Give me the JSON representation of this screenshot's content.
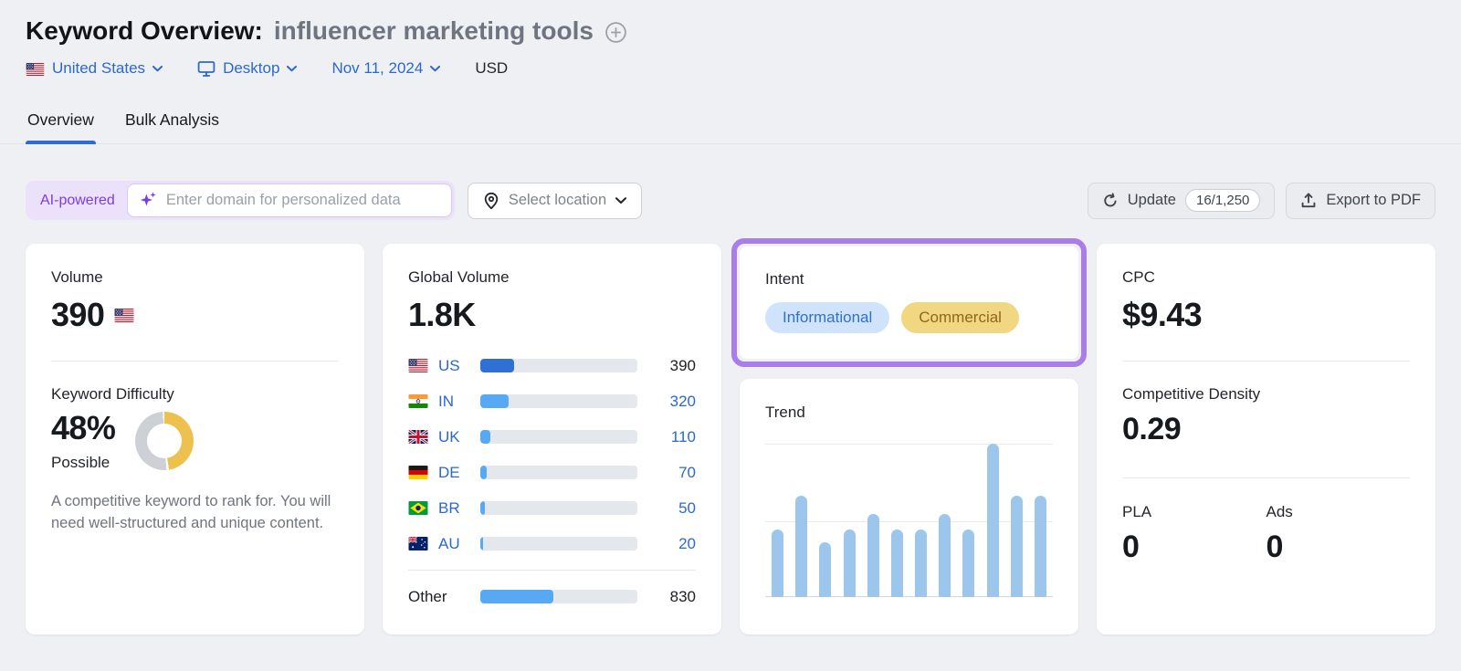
{
  "colors": {
    "accent_blue": "#2b68cf",
    "tab_underline_blue": "#2e6bd8",
    "highlight_purple": "#ab7de8",
    "ai_purple": "#7b3be8",
    "kd_ring_yellow": "#ecc14e",
    "kd_ring_gray": "#cdd1d6",
    "trend_bar_blue": "#9cc6ec",
    "us_bar_blue": "#2f70d4",
    "country_bar_blue": "#58a9f3",
    "informational_text": "#3270c8",
    "informational_bg": "#cfe4fb",
    "commercial_text": "#8d681a",
    "commercial_bg": "#f2d783"
  },
  "header": {
    "title": "Keyword Overview:",
    "keyword": "influencer marketing tools",
    "filters": {
      "country": "United States",
      "device": "Desktop",
      "date": "Nov 11, 2024",
      "currency": "USD"
    },
    "tabs": [
      {
        "label": "Overview"
      },
      {
        "label": "Bulk Analysis"
      }
    ]
  },
  "toolbar": {
    "ai_badge": "AI-powered",
    "domain_placeholder": "Enter domain for personalized data",
    "select_location": "Select location",
    "update_label": "Update",
    "update_count": "16/1,250",
    "export_label": "Export to PDF"
  },
  "cards": {
    "volume": {
      "label": "Volume",
      "value": "390"
    },
    "keyword_difficulty": {
      "label": "Keyword Difficulty",
      "value": "48%",
      "percent": 48,
      "verdict": "Possible",
      "description": "A competitive keyword to rank for. You will need well-structured and unique content."
    },
    "global_volume": {
      "label": "Global Volume",
      "value": "1.8K",
      "rows": [
        {
          "code": "US",
          "flag": "us",
          "value": 390,
          "display": "390",
          "emphasis": true
        },
        {
          "code": "IN",
          "flag": "in",
          "value": 320,
          "display": "320",
          "emphasis": false
        },
        {
          "code": "UK",
          "flag": "uk",
          "value": 110,
          "display": "110",
          "emphasis": false
        },
        {
          "code": "DE",
          "flag": "de",
          "value": 70,
          "display": "70",
          "emphasis": false
        },
        {
          "code": "BR",
          "flag": "br",
          "value": 50,
          "display": "50",
          "emphasis": false
        },
        {
          "code": "AU",
          "flag": "au",
          "value": 20,
          "display": "20",
          "emphasis": false
        }
      ],
      "other": {
        "label": "Other",
        "value": 830,
        "display": "830"
      }
    },
    "intent": {
      "label": "Intent",
      "tags": [
        {
          "label": "Informational",
          "type": "informational"
        },
        {
          "label": "Commercial",
          "type": "commercial"
        }
      ]
    },
    "trend": {
      "label": "Trend"
    },
    "cpc": {
      "label": "CPC",
      "value": "$9.43"
    },
    "competitive_density": {
      "label": "Competitive Density",
      "value": "0.29"
    },
    "pla": {
      "label": "PLA",
      "value": "0"
    },
    "ads": {
      "label": "Ads",
      "value": "0"
    }
  },
  "chart_data": [
    {
      "type": "bar",
      "title": "Trend",
      "values": [
        44,
        66,
        36,
        44,
        54,
        44,
        44,
        54,
        44,
        100,
        66,
        66
      ],
      "ylim": [
        0,
        100
      ],
      "grid": true,
      "legend_position": "none"
    },
    {
      "type": "bar",
      "title": "Global Volume",
      "orientation": "horizontal",
      "categories": [
        "US",
        "IN",
        "UK",
        "DE",
        "BR",
        "AU",
        "Other"
      ],
      "values": [
        390,
        320,
        110,
        70,
        50,
        20,
        830
      ],
      "total": "1.8K"
    }
  ]
}
